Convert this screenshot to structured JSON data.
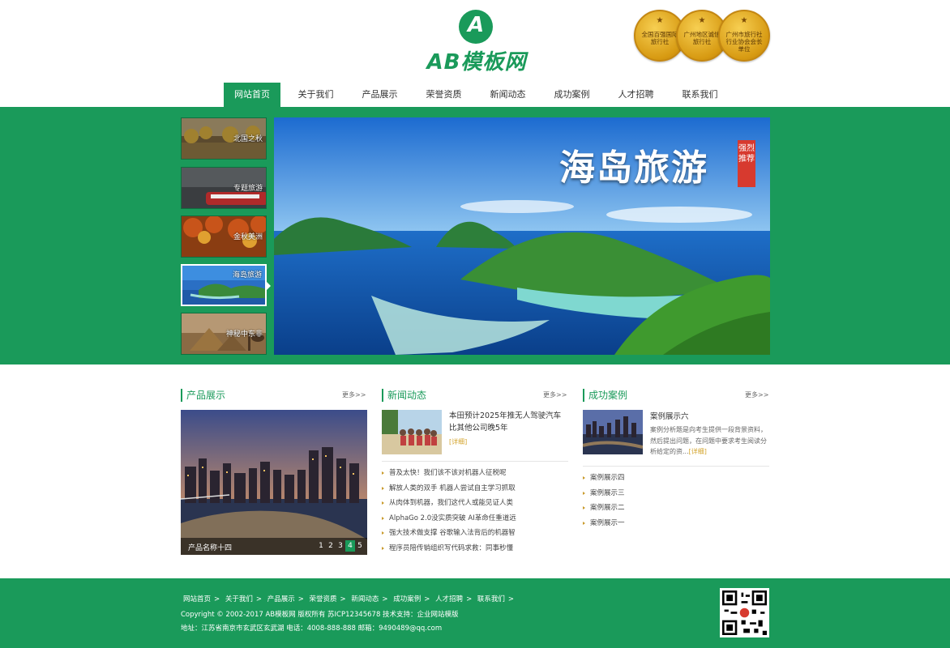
{
  "brand": {
    "logo_letter": "A",
    "logo_text": "AB模板网",
    "color": "#1a9a5a"
  },
  "badges": [
    {
      "text": "全国百强国际旅行社"
    },
    {
      "text": "广州地区诚信旅行社"
    },
    {
      "text": "广州市旅行社行业协会会长单位"
    }
  ],
  "nav": [
    {
      "label": "网站首页",
      "active": true
    },
    {
      "label": "关于我们"
    },
    {
      "label": "产品展示"
    },
    {
      "label": "荣誉资质"
    },
    {
      "label": "新闻动态"
    },
    {
      "label": "成功案例"
    },
    {
      "label": "人才招聘"
    },
    {
      "label": "联系我们"
    }
  ],
  "banner": {
    "thumbs": [
      {
        "label": "北国之秋"
      },
      {
        "label": "专题旅游"
      },
      {
        "label": "金秋美洲"
      },
      {
        "label": "海岛旅游"
      },
      {
        "label": "神秘中东非"
      }
    ],
    "main_title": "海岛旅游",
    "main_tag": "强烈推荐"
  },
  "products": {
    "title": "产品展示",
    "more": "更多>>",
    "caption": "产品名称十四",
    "pages": [
      "1",
      "2",
      "3",
      "4",
      "5"
    ],
    "active_page": "4"
  },
  "news": {
    "title": "新闻动态",
    "more": "更多>>",
    "featured_title": "本田预计2025年推无人驾驶汽车 比其他公司晚5年",
    "detail": "[详细]",
    "items": [
      "普及太快！我们该不该对机器人征税呢",
      "解放人类的双手 机器人尝试自主学习抓取",
      "从肉体到机器，我们这代人或能见证人类",
      "AlphaGo 2.0没实质突破 AI革命任重道远",
      "强大技术做支撑 谷歌输入法背后的机器智",
      "程序员陪传销组织写代码求救：同事秒懂"
    ]
  },
  "cases": {
    "title": "成功案例",
    "more": "更多>>",
    "featured_title": "案例展示六",
    "featured_desc": "案例分析题是向考生提供一段背景资料，然后提出问题，在问题中要求考生阅读分析给定的资...",
    "detail": "[详细]",
    "items": [
      "案例展示四",
      "案例展示三",
      "案例展示二",
      "案例展示一"
    ]
  },
  "footer": {
    "links": [
      "网站首页",
      ">",
      "关于我们",
      ">",
      "产品展示",
      ">",
      "荣誉资质",
      ">",
      "新闻动态",
      ">",
      "成功案例",
      ">",
      "人才招聘",
      ">",
      "联系我们",
      ">"
    ],
    "copyright": "Copyright © 2002-2017 AB模板网 版权所有  苏ICP12345678  技术支持：企业网站模版",
    "address": "地址：江苏省南京市玄武区玄武湖   电话：4008-888-888   邮箱：9490489@qq.com"
  }
}
